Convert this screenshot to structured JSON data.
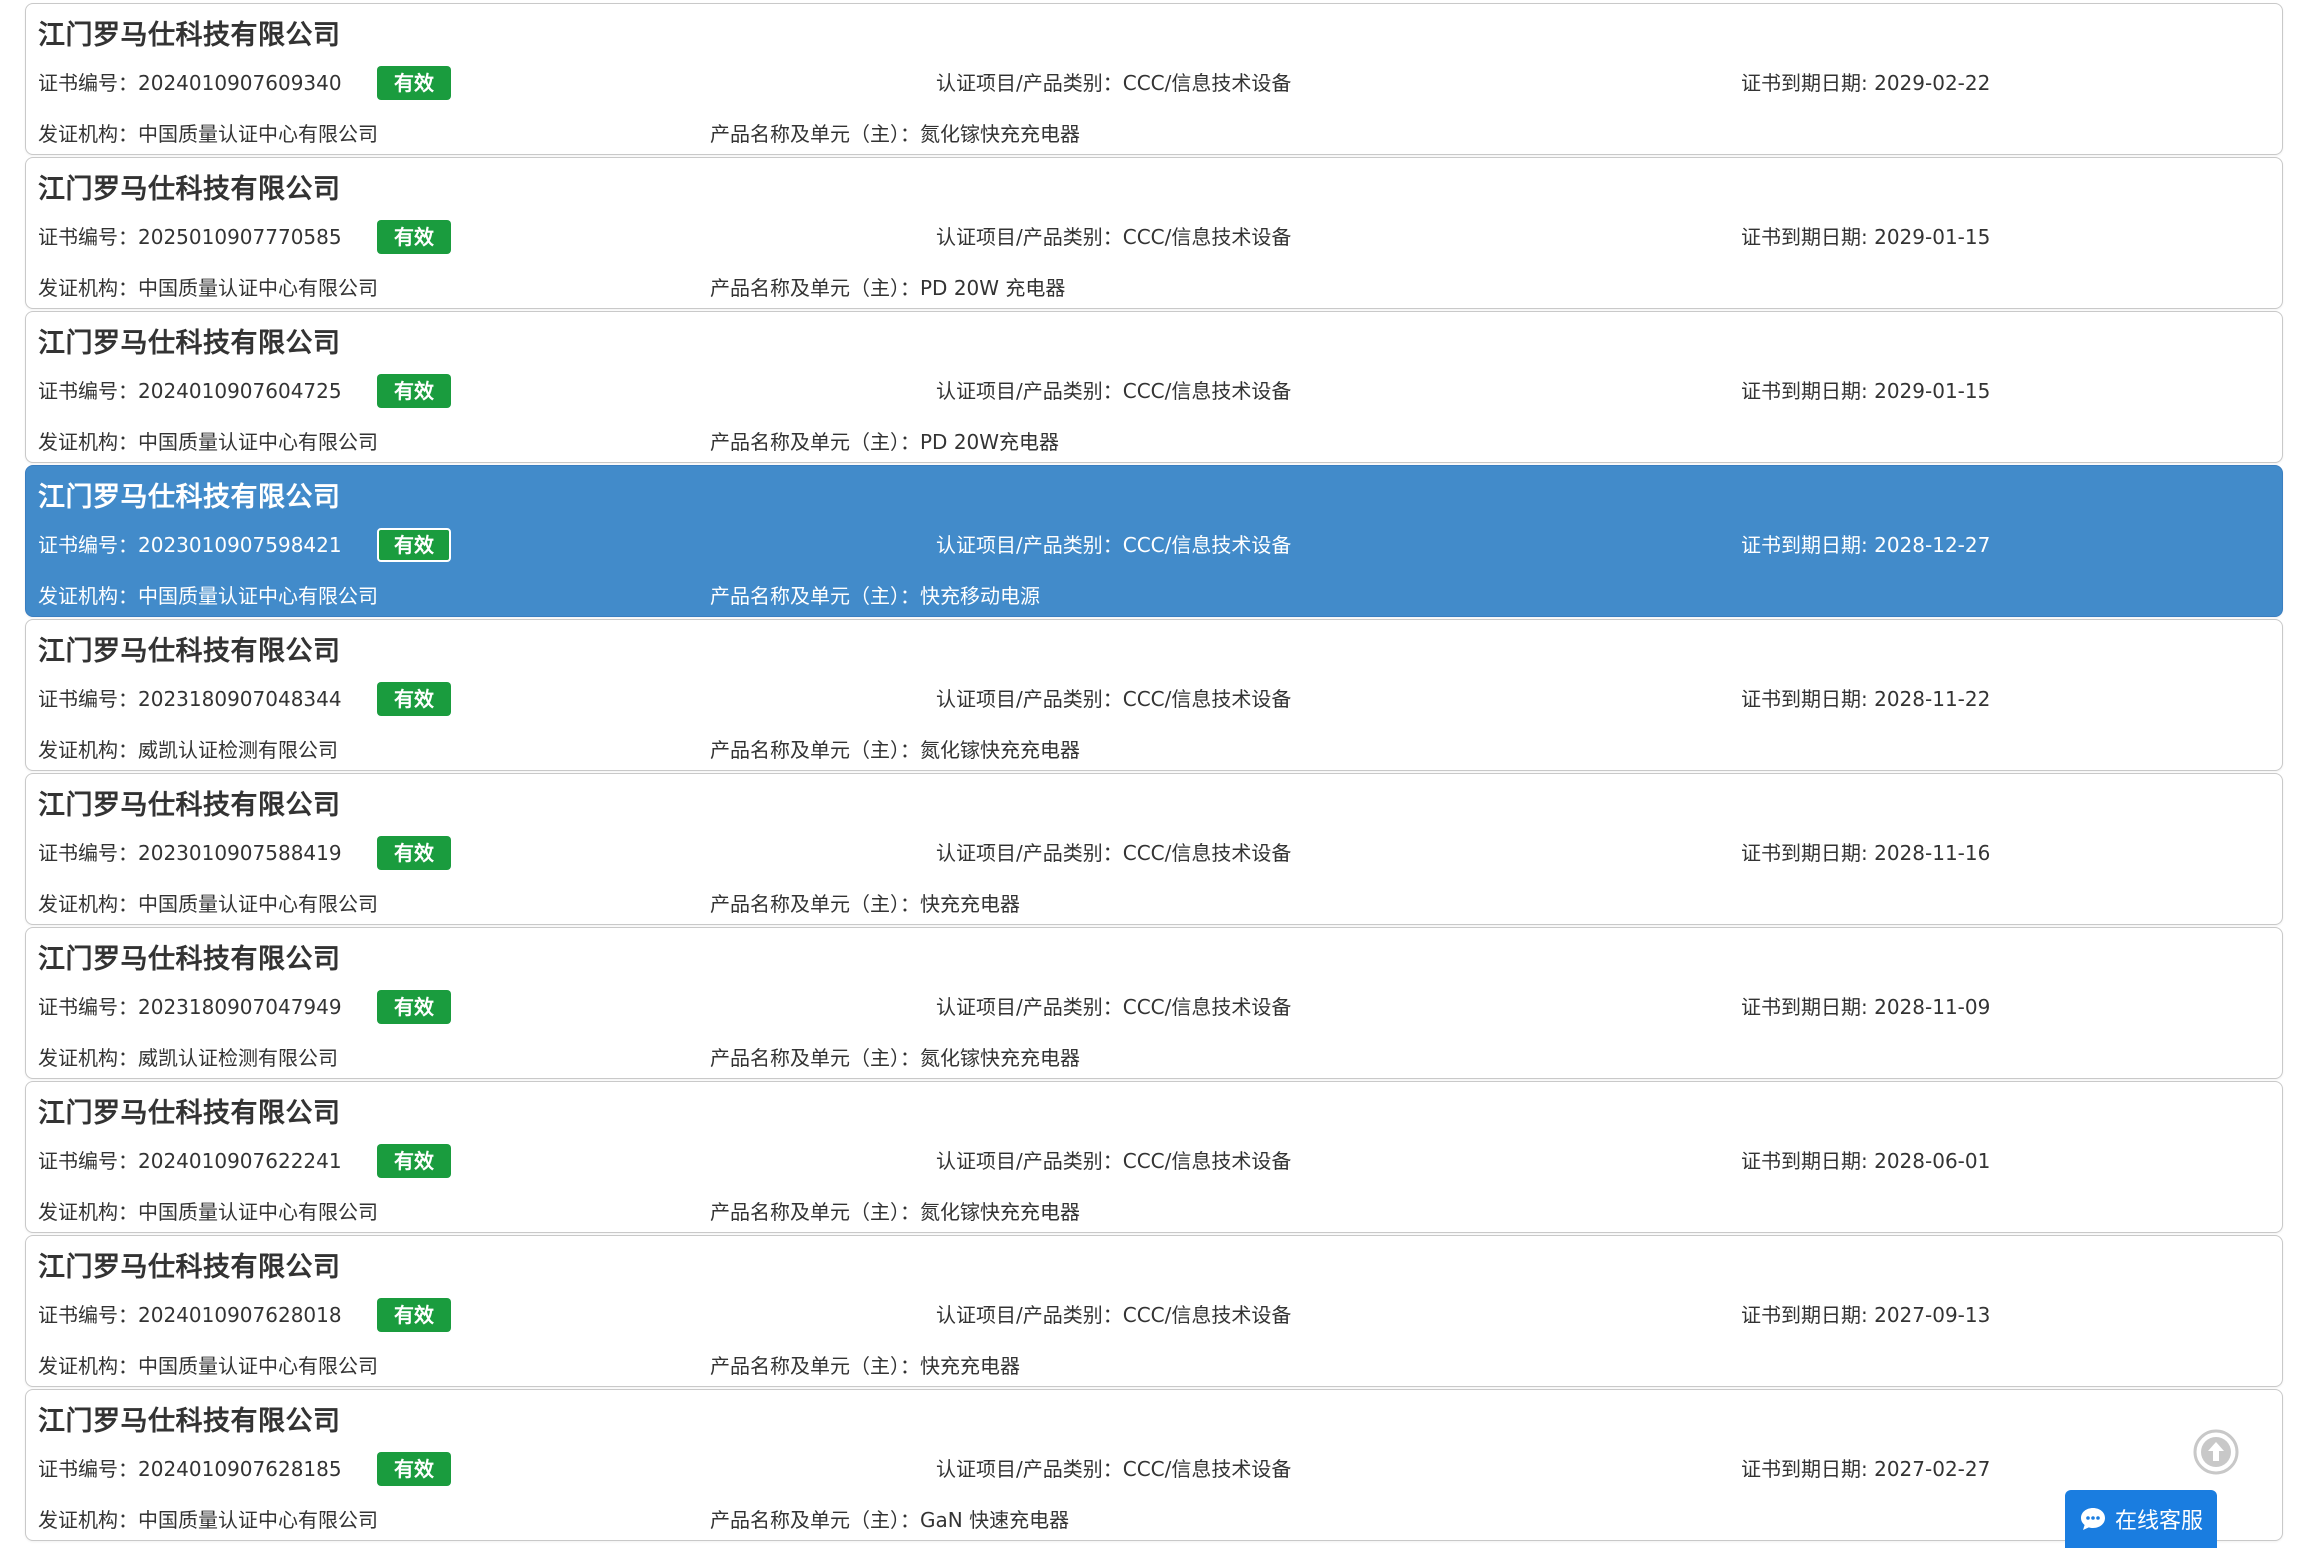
{
  "labels": {
    "cert_no": "证书编号：",
    "cert_item": "认证项目/产品类别：",
    "expiry": "证书到期日期: ",
    "issuer": "发证机构：",
    "product": "产品名称及单元（主）："
  },
  "colors": {
    "selected_bg": "#428bca",
    "valid_badge": "#1a9c3e",
    "chat_button": "#1a7de0"
  },
  "records": [
    {
      "company": "江门罗马仕科技有限公司",
      "cert_no": "2024010907609340",
      "status": "有效",
      "cert_item": "CCC/信息技术设备",
      "expiry": "2029-02-22",
      "issuer": "中国质量认证中心有限公司",
      "product": "氮化镓快充充电器",
      "selected": false
    },
    {
      "company": "江门罗马仕科技有限公司",
      "cert_no": "2025010907770585",
      "status": "有效",
      "cert_item": "CCC/信息技术设备",
      "expiry": "2029-01-15",
      "issuer": "中国质量认证中心有限公司",
      "product": "PD 20W 充电器",
      "selected": false
    },
    {
      "company": "江门罗马仕科技有限公司",
      "cert_no": "2024010907604725",
      "status": "有效",
      "cert_item": "CCC/信息技术设备",
      "expiry": "2029-01-15",
      "issuer": "中国质量认证中心有限公司",
      "product": "PD 20W充电器",
      "selected": false
    },
    {
      "company": "江门罗马仕科技有限公司",
      "cert_no": "2023010907598421",
      "status": "有效",
      "cert_item": "CCC/信息技术设备",
      "expiry": "2028-12-27",
      "issuer": "中国质量认证中心有限公司",
      "product": "快充移动电源",
      "selected": true
    },
    {
      "company": "江门罗马仕科技有限公司",
      "cert_no": "2023180907048344",
      "status": "有效",
      "cert_item": "CCC/信息技术设备",
      "expiry": "2028-11-22",
      "issuer": "威凯认证检测有限公司",
      "product": "氮化镓快充充电器",
      "selected": false
    },
    {
      "company": "江门罗马仕科技有限公司",
      "cert_no": "2023010907588419",
      "status": "有效",
      "cert_item": "CCC/信息技术设备",
      "expiry": "2028-11-16",
      "issuer": "中国质量认证中心有限公司",
      "product": "快充充电器",
      "selected": false
    },
    {
      "company": "江门罗马仕科技有限公司",
      "cert_no": "2023180907047949",
      "status": "有效",
      "cert_item": "CCC/信息技术设备",
      "expiry": "2028-11-09",
      "issuer": "威凯认证检测有限公司",
      "product": "氮化镓快充充电器",
      "selected": false
    },
    {
      "company": "江门罗马仕科技有限公司",
      "cert_no": "2024010907622241",
      "status": "有效",
      "cert_item": "CCC/信息技术设备",
      "expiry": "2028-06-01",
      "issuer": "中国质量认证中心有限公司",
      "product": "氮化镓快充充电器",
      "selected": false
    },
    {
      "company": "江门罗马仕科技有限公司",
      "cert_no": "2024010907628018",
      "status": "有效",
      "cert_item": "CCC/信息技术设备",
      "expiry": "2027-09-13",
      "issuer": "中国质量认证中心有限公司",
      "product": "快充充电器",
      "selected": false
    },
    {
      "company": "江门罗马仕科技有限公司",
      "cert_no": "2024010907628185",
      "status": "有效",
      "cert_item": "CCC/信息技术设备",
      "expiry": "2027-02-27",
      "issuer": "中国质量认证中心有限公司",
      "product": "GaN 快速充电器",
      "selected": false
    }
  ],
  "chat": {
    "label": "在线客服",
    "icon": "chat-bubble-icon"
  },
  "scroll_top": {
    "icon": "arrow-up-circle-icon"
  }
}
